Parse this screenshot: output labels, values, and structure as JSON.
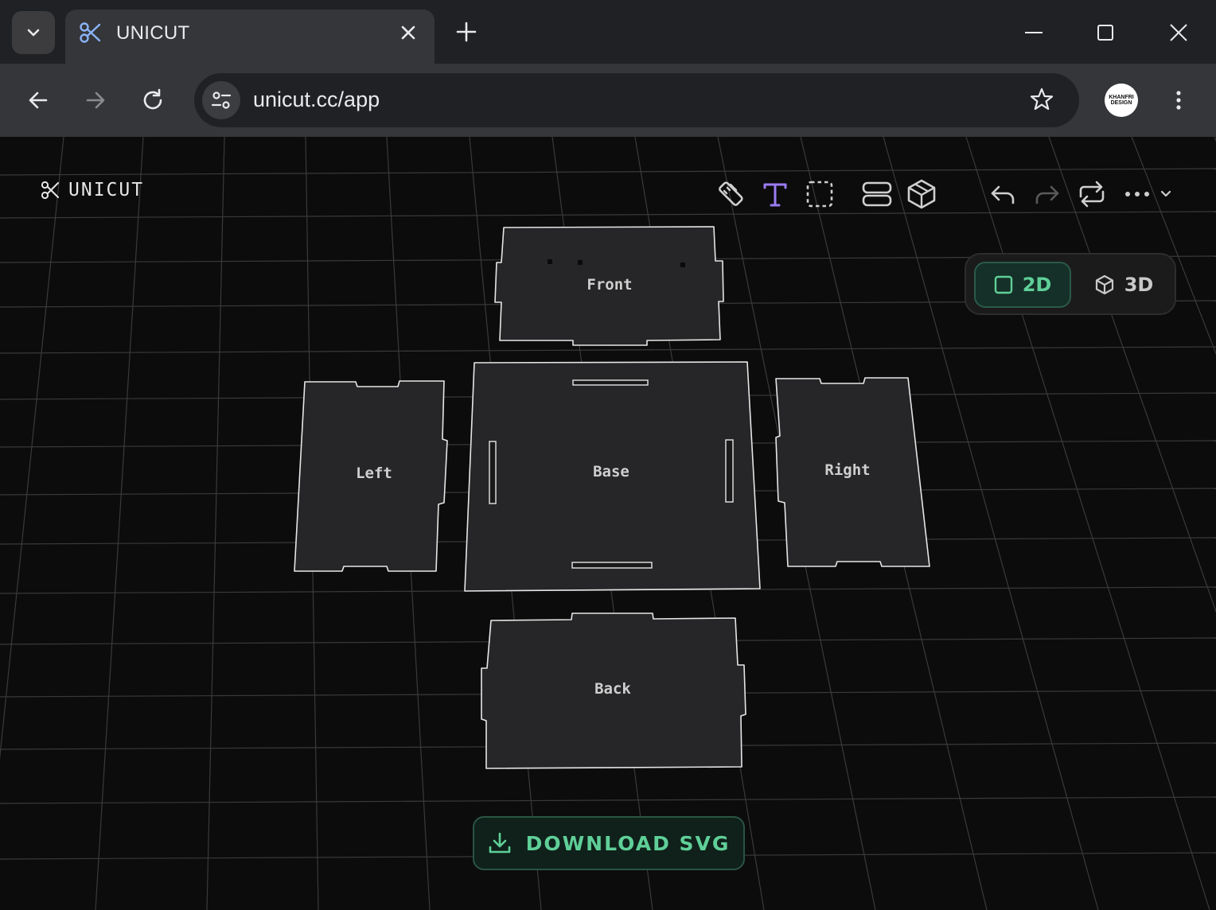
{
  "browser": {
    "tab_title": "UNICUT",
    "url": "unicut.cc/app",
    "avatar_text_line1": "KHANFRI",
    "avatar_text_line2": "DESIGN"
  },
  "app": {
    "brand": "UNICUT",
    "tools": [
      "ruler-icon",
      "text-icon",
      "select-icon",
      "layers-icon",
      "box-icon"
    ],
    "history": [
      "undo-icon",
      "redo-icon",
      "repeat-icon",
      "more-icon"
    ],
    "view_toggle": {
      "option_2d": "2D",
      "option_3d": "3D",
      "selected": "2D"
    },
    "pieces": {
      "front": "Front",
      "left": "Left",
      "base": "Base",
      "right": "Right",
      "back": "Back"
    },
    "download_label": "DOWNLOAD SVG",
    "colors": {
      "accent_green": "#5fcf98",
      "accent_purple": "#9b7cf4",
      "piece_fill": "#262628",
      "piece_stroke": "#e6e6e6"
    }
  }
}
